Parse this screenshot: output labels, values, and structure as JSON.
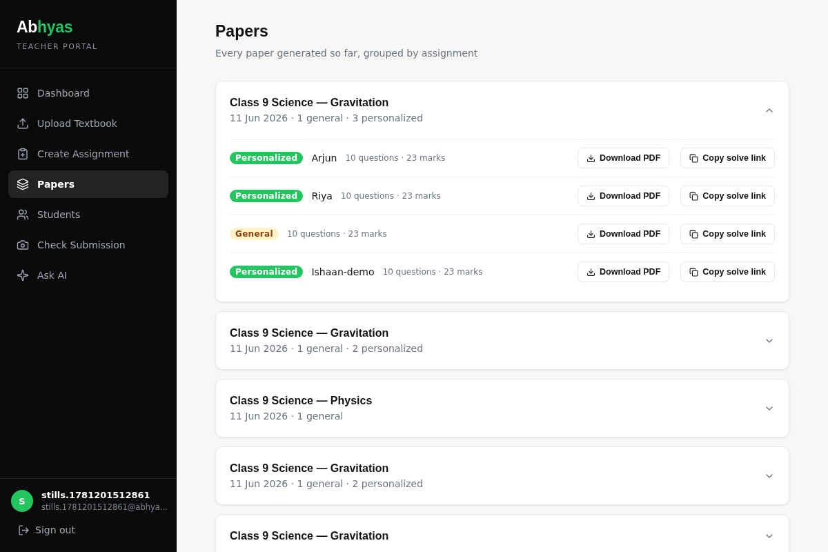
{
  "sidebar": {
    "logo": {
      "plain": "Ab",
      "accent": "hyas"
    },
    "subtitle": "TEACHER PORTAL",
    "items": [
      {
        "label": "Dashboard",
        "selected": false
      },
      {
        "label": "Upload Textbook",
        "selected": false
      },
      {
        "label": "Create Assignment",
        "selected": false
      },
      {
        "label": "Papers",
        "selected": true
      },
      {
        "label": "Students",
        "selected": false
      },
      {
        "label": "Check Submission",
        "selected": false
      },
      {
        "label": "Ask AI",
        "selected": false
      }
    ],
    "user": {
      "initial": "S",
      "name": "stills.1781201512861",
      "email": "stills.1781201512861@abhya..."
    },
    "sign_out": "Sign out"
  },
  "page": {
    "title": "Papers",
    "subtitle": "Every paper generated so far, grouped by assignment"
  },
  "groups": [
    {
      "title": "Class 9 Science — Gravitation",
      "meta": "11 Jun 2026 · 1 general · 3 personalized",
      "expanded": true,
      "papers": [
        {
          "kind": "personalized",
          "badge": "Personalized",
          "student": "Arjun",
          "info": "10 questions · 23 marks",
          "download": "Download PDF",
          "copy": "Copy solve link"
        },
        {
          "kind": "personalized",
          "badge": "Personalized",
          "student": "Riya",
          "info": "10 questions · 23 marks",
          "download": "Download PDF",
          "copy": "Copy solve link"
        },
        {
          "kind": "general",
          "badge": "General",
          "info": "10 questions · 23 marks",
          "download": "Download PDF",
          "copy": "Copy solve link"
        },
        {
          "kind": "personalized",
          "badge": "Personalized",
          "student": "Ishaan-demo",
          "info": "10 questions · 23 marks",
          "download": "Download PDF",
          "copy": "Copy solve link"
        }
      ]
    },
    {
      "title": "Class 9 Science — Gravitation",
      "meta": "11 Jun 2026 · 1 general · 2 personalized",
      "expanded": false
    },
    {
      "title": "Class 9 Science — Physics",
      "meta": "11 Jun 2026 · 1 general",
      "expanded": false
    },
    {
      "title": "Class 9 Science — Gravitation",
      "meta": "11 Jun 2026 · 1 general · 2 personalized",
      "expanded": false
    },
    {
      "title": "Class 9 Science — Gravitation",
      "expanded": false
    }
  ]
}
